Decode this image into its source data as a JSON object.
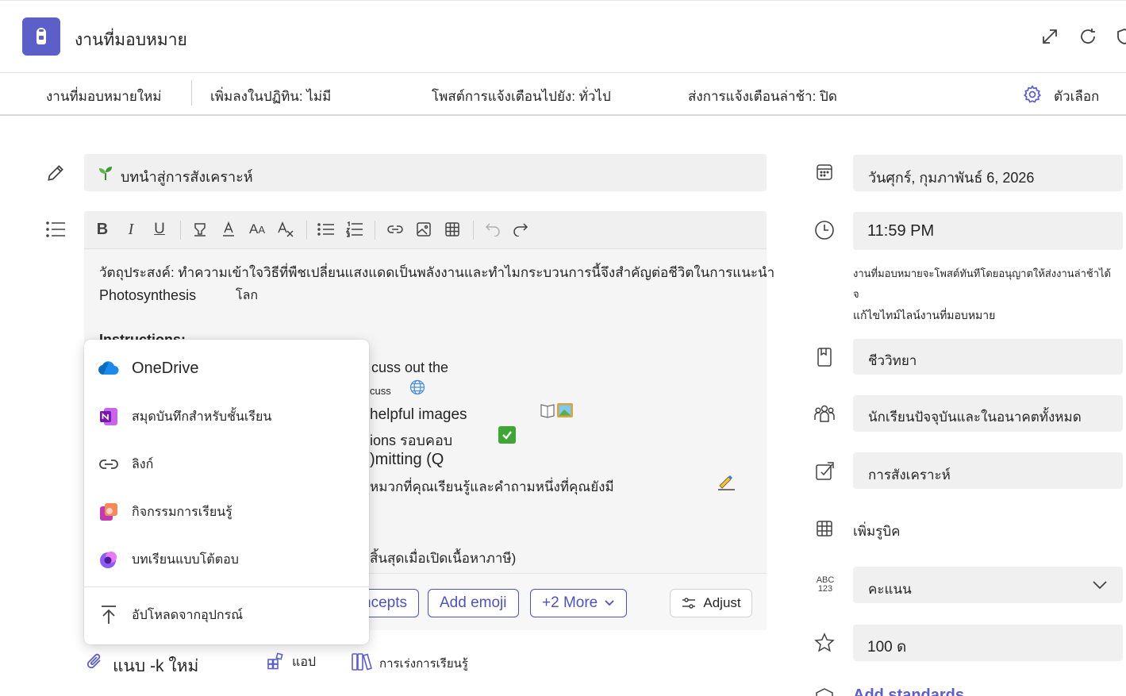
{
  "header": {
    "title": "งานที่มอบหมาย",
    "icons": [
      "expand-icon",
      "refresh-icon",
      "shield-icon"
    ]
  },
  "toolbar": {
    "new_assignment": "งานที่มอบหมายใหม่",
    "add_to_calendar": "เพิ่มลงในปฏิทิน: ไม่มี",
    "post_notifications": "โพสต์การแจ้งเตือนไปยัง: ทั่วไป",
    "late_notifications": "ส่งการแจ้งเตือนล่าช้า: ปิด",
    "options_label": "ตัวเลือก"
  },
  "title_field": {
    "value": "บทนำสู่การสังเคราะห์"
  },
  "editor": {
    "line1": "วัตถุประสงค์: ทำความเข้าใจวิธีที่พืชเปลี่ยนแสงแดดเป็นพลังงานและทำไมกระบวนการนี้จึงสำคัญต่อชีวิตในการแนะนำ",
    "line2a": "Photosynthesis",
    "line2b": "โลก",
    "line3": "Instructions:",
    "frag1": "cuss out the",
    "frag2": "cuss",
    "frag3": "helpful images",
    "frag4": "ions รอบคอบ",
    "frag5": ")mitting (Q",
    "frag6": "หมวกที่คุณเรียนรู้และคำถามหนึ่งที่คุณยังมี",
    "frag7": "สิ้นสุดเมื่อเปิดเนื้อหาภาษี)"
  },
  "chips": {
    "concepts": "ncepts",
    "add_emoji": "Add emoji",
    "more": "+2 More",
    "adjust": "Adjust"
  },
  "attach_menu": {
    "items": [
      {
        "label": "OneDrive",
        "icon": "onedrive-icon"
      },
      {
        "label": "สมุดบันทึกสำหรับชั้นเรียน",
        "icon": "onenote-icon"
      },
      {
        "label": "ลิงก์",
        "icon": "link-icon"
      },
      {
        "label": "กิจกรรมการเรียนรู้",
        "icon": "learning-activity-icon"
      },
      {
        "label": "บทเรียนแบบโต้ตอบ",
        "icon": "interactive-lesson-icon"
      },
      {
        "label": "อัปโหลดจากอุปกรณ์",
        "icon": "upload-icon"
      }
    ]
  },
  "attach_row": {
    "attach": "แนบ -k ใหม่",
    "apps": "แอป",
    "learning_accelerators": "การเร่งการเรียนรู้"
  },
  "right": {
    "due_date": "วันศุกร์, กุมภาพันธ์ 6, 2026",
    "due_time": "11:59 PM",
    "note_line1": "งานที่มอบหมายจะโพสต์ทันทีโดยอนุญาตให้ส่งงานล่าช้าได้",
    "note_line2": "จ",
    "edit_timeline": "แก้ไขไทม์ไลน์งานที่มอบหมาย",
    "category": "ชีววิทยา",
    "assign_to": "นักเรียนปัจจุบันและในอนาคตทั้งหมด",
    "tag": "การสังเคราะห์",
    "add_rubric": "เพิ่มรูบิค",
    "grading": "คะแนน",
    "points": "100 ด",
    "add_standards": "Add standards"
  },
  "colors": {
    "brand": "#5b5fc7",
    "chip_accent": "#4f52b2"
  }
}
